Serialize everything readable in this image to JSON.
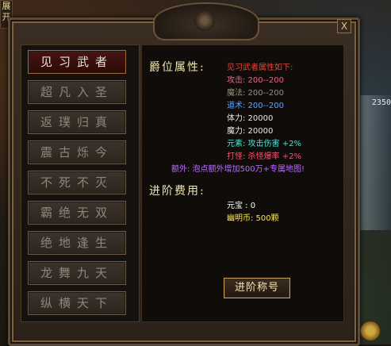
{
  "window": {
    "close_label": "X",
    "side_tag": "展开",
    "background_number": "2350"
  },
  "menu": {
    "items": [
      {
        "label": "见习武者",
        "active": true
      },
      {
        "label": "超凡入圣",
        "active": false
      },
      {
        "label": "返璞归真",
        "active": false
      },
      {
        "label": "震古烁今",
        "active": false
      },
      {
        "label": "不死不灭",
        "active": false
      },
      {
        "label": "霸绝无双",
        "active": false
      },
      {
        "label": "绝地逢生",
        "active": false
      },
      {
        "label": "龙舞九天",
        "active": false
      },
      {
        "label": "纵横天下",
        "active": false
      }
    ]
  },
  "attributes": {
    "section_title": "爵位属性:",
    "heading": "见习武者属性如下:",
    "attack": "攻击: 200--200",
    "magic": "魔法: 200--200",
    "tao": "道术: 200--200",
    "hp": "体力: 20000",
    "mp": "魔力: 20000",
    "element": "元素: 攻击伤害 +2%",
    "kill_drop": "打怪: 杀怪爆率 +2%",
    "extra": "额外: 泡点额外增加500万+专属地图!"
  },
  "cost": {
    "section_title": "进阶费用:",
    "yuanbao": "元宝 : 0",
    "youming": "幽明币: 500颗"
  },
  "actions": {
    "advance_label": "进阶称号"
  },
  "colors": {
    "attack": "#ff5a8e",
    "magic": "#9a8f7e",
    "tao": "#5aa8ff",
    "element": "#3ee8d8",
    "hit": "#ff4f6f",
    "extra": "#b76cff",
    "gold": "#ffe94a"
  }
}
